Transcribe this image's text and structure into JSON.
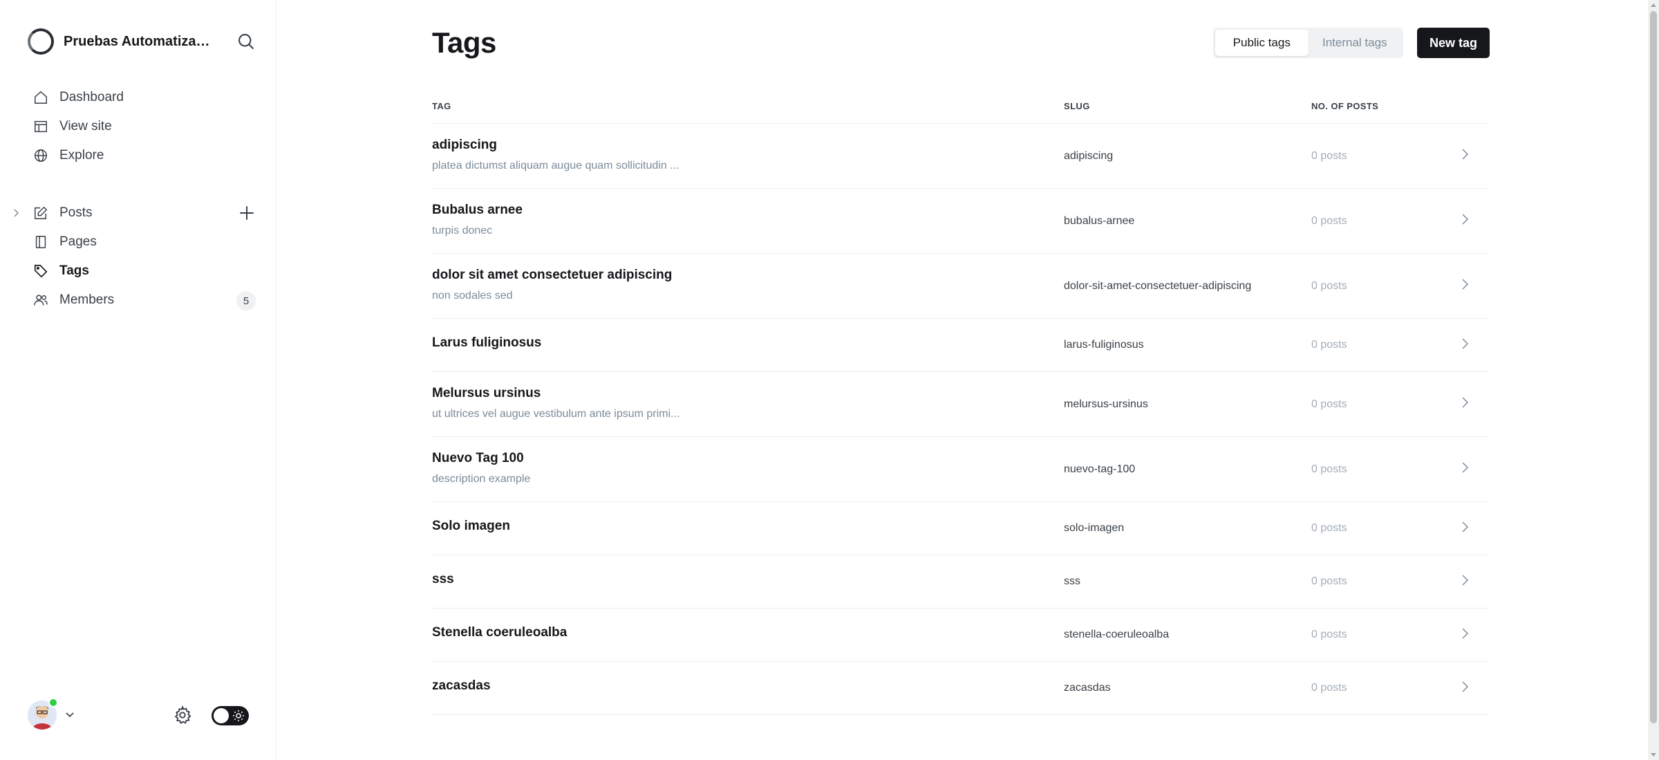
{
  "sidebar": {
    "site_title": "Pruebas Automatizadas",
    "nav_top": [
      {
        "label": "Dashboard",
        "icon": "home-icon"
      },
      {
        "label": "View site",
        "icon": "layout-icon"
      },
      {
        "label": "Explore",
        "icon": "globe-icon"
      }
    ],
    "nav_main": [
      {
        "label": "Posts",
        "icon": "edit-icon"
      },
      {
        "label": "Pages",
        "icon": "page-icon"
      },
      {
        "label": "Tags",
        "icon": "tag-icon",
        "active": true
      },
      {
        "label": "Members",
        "icon": "members-icon",
        "badge": "5"
      }
    ]
  },
  "header": {
    "title": "Tags",
    "filter_public": "Public tags",
    "filter_internal": "Internal tags",
    "new_tag": "New tag"
  },
  "table": {
    "columns": [
      "Tag",
      "Slug",
      "No. of posts"
    ],
    "rows": [
      {
        "name": "adipiscing",
        "description": "platea dictumst aliquam augue quam sollicitudin ...",
        "slug": "adipiscing",
        "posts": "0 posts"
      },
      {
        "name": "Bubalus arnee",
        "description": "turpis donec",
        "slug": "bubalus-arnee",
        "posts": "0 posts"
      },
      {
        "name": "dolor sit amet consectetuer adipiscing",
        "description": "non sodales sed",
        "slug": "dolor-sit-amet-consectetuer-adipiscing",
        "posts": "0 posts"
      },
      {
        "name": "Larus fuliginosus",
        "description": "",
        "slug": "larus-fuliginosus",
        "posts": "0 posts"
      },
      {
        "name": "Melursus ursinus",
        "description": "ut ultrices vel augue vestibulum ante ipsum primi...",
        "slug": "melursus-ursinus",
        "posts": "0 posts"
      },
      {
        "name": "Nuevo Tag 100",
        "description": "description example",
        "slug": "nuevo-tag-100",
        "posts": "0 posts"
      },
      {
        "name": "Solo imagen",
        "description": "",
        "slug": "solo-imagen",
        "posts": "0 posts"
      },
      {
        "name": "sss",
        "description": "",
        "slug": "sss",
        "posts": "0 posts"
      },
      {
        "name": "Stenella coeruleoalba",
        "description": "",
        "slug": "stenella-coeruleoalba",
        "posts": "0 posts"
      },
      {
        "name": "zacasdas",
        "description": "",
        "slug": "zacasdas",
        "posts": "0 posts"
      }
    ]
  },
  "colors": {
    "primary_text": "#15171a",
    "muted_text": "#7c8b9a",
    "online_dot": "#30cf43",
    "button_dark": "#15171a"
  }
}
